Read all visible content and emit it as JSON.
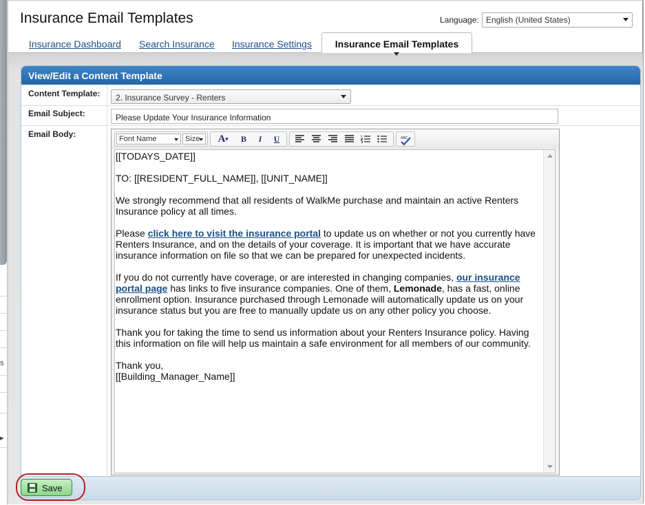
{
  "window": {
    "title": "Insurance Email Templates"
  },
  "language": {
    "label": "Language:",
    "value": "English (United States)"
  },
  "tabs": [
    {
      "label": "Insurance Dashboard"
    },
    {
      "label": "Search Insurance"
    },
    {
      "label": "Insurance Settings"
    },
    {
      "label": "Insurance Email Templates",
      "active": true
    }
  ],
  "panel": {
    "title": "View/Edit a Content Template"
  },
  "form": {
    "content_template_label": "Content Template:",
    "content_template_value": "2. Insurance Survey - Renters",
    "subject_label": "Email Subject:",
    "subject_value": "Please Update Your Insurance Information",
    "body_label": "Email Body:"
  },
  "toolbar": {
    "font_name": "Font Name",
    "size": "Size",
    "icons": [
      "font-color-icon",
      "bold-icon",
      "italic-icon",
      "underline-icon",
      "align-left-icon",
      "align-center-icon",
      "align-right-icon",
      "justify-icon",
      "numbered-list-icon",
      "bulleted-list-icon",
      "spellcheck-icon"
    ]
  },
  "email_body": {
    "date_token": "[[TODAYS_DATE]]",
    "to_line": "TO: [[RESIDENT_FULL_NAME]], [[UNIT_NAME]]",
    "para1": "We strongly recommend that all residents of WalkMe purchase and maintain an active Renters Insurance policy at all times.",
    "para2_pre": "Please ",
    "para2_link": "click here to visit the insurance portal",
    "para2_post": " to update us on whether or not you currently have Renters Insurance, and on the details of your coverage. It is important that we have accurate insurance information on file so that we can be prepared for unexpected incidents.",
    "para3_pre": "If you do not currently have coverage, or are interested in changing companies, ",
    "para3_link": "our insurance portal page",
    "para3_mid": " has links to five insurance companies. One of them, ",
    "para3_bold": "Lemonade",
    "para3_post": ", has a fast, online enrollment option. Insurance purchased through Lemonade will automatically update us on your insurance status but you are free to manually update us on any other policy you choose.",
    "para4": "Thank you for taking the time to send us information about your Renters Insurance policy. Having this information on file will help us maintain a safe environment for all members of our community.",
    "closing": "Thank you,",
    "signature": "[[Building_Manager_Name]]"
  },
  "actions": {
    "save_label": "Save"
  },
  "background_fragments": {
    "s": "s"
  },
  "colors": {
    "header_blue": "#2466a8",
    "link_blue": "#1a4f8a",
    "save_green": "#8fd58b",
    "highlight_red": "#b5201e"
  }
}
